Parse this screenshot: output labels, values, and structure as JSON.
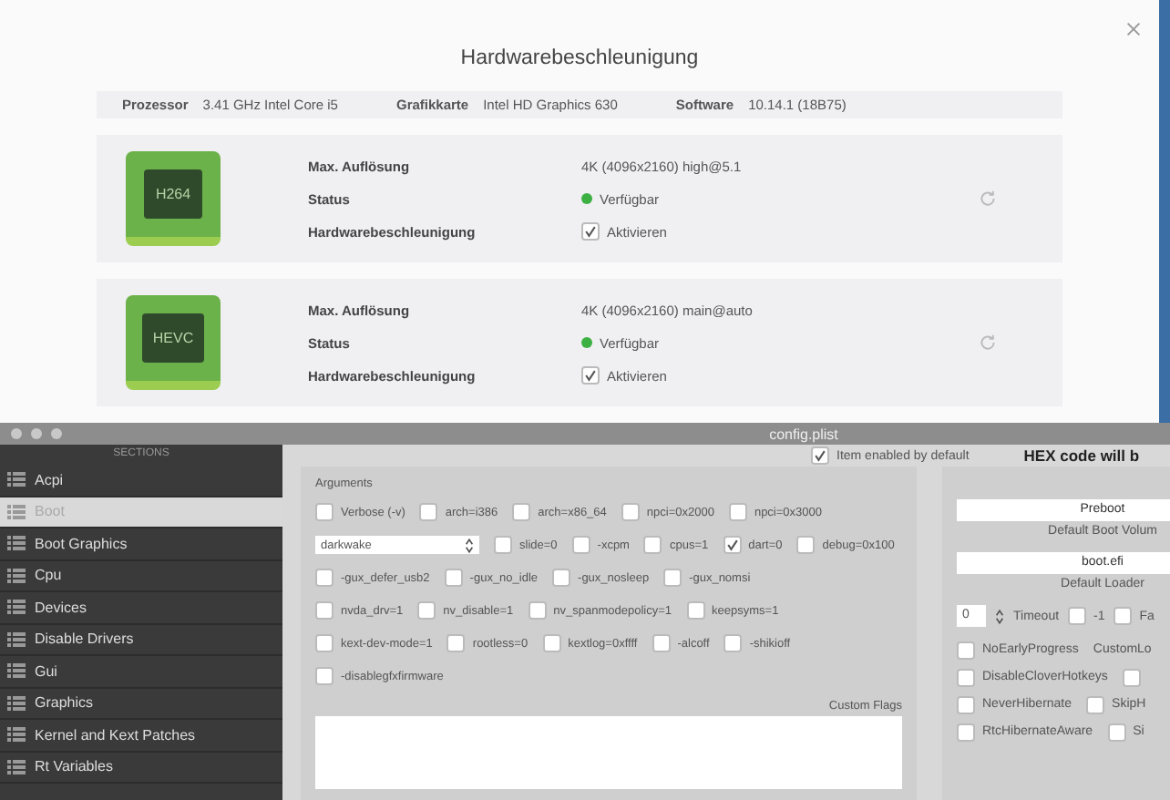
{
  "hardware_window": {
    "title": "Hardwarebeschleunigung",
    "info": [
      {
        "label": "Prozessor",
        "value": "3.41 GHz Intel Core i5"
      },
      {
        "label": "Grafikkarte",
        "value": "Intel HD Graphics 630"
      },
      {
        "label": "Software",
        "value": "10.14.1 (18B75)"
      }
    ],
    "codecs": [
      {
        "chip": "H264",
        "fields": [
          {
            "kind": "text",
            "label": "Max. Auflösung",
            "value": "4K (4096x2160) high@5.1"
          },
          {
            "kind": "status",
            "label": "Status",
            "value": "Verfügbar",
            "color": "#3cb043"
          },
          {
            "kind": "checkbox",
            "label": "Hardwarebeschleunigung",
            "value": "Aktivieren",
            "checked": true
          }
        ]
      },
      {
        "chip": "HEVC",
        "fields": [
          {
            "kind": "text",
            "label": "Max. Auflösung",
            "value": "4K (4096x2160) main@auto"
          },
          {
            "kind": "status",
            "label": "Status",
            "value": "Verfügbar",
            "color": "#3cb043"
          },
          {
            "kind": "checkbox",
            "label": "Hardwarebeschleunigung",
            "value": "Aktivieren",
            "checked": true
          }
        ]
      }
    ]
  },
  "config_window": {
    "title": "config.plist",
    "sidebar": {
      "header": "SECTIONS",
      "items": [
        {
          "label": "Acpi",
          "selected": false
        },
        {
          "label": "Boot",
          "selected": true
        },
        {
          "label": "Boot Graphics",
          "selected": false
        },
        {
          "label": "Cpu",
          "selected": false
        },
        {
          "label": "Devices",
          "selected": false
        },
        {
          "label": "Disable Drivers",
          "selected": false
        },
        {
          "label": "Gui",
          "selected": false
        },
        {
          "label": "Graphics",
          "selected": false
        },
        {
          "label": "Kernel and Kext Patches",
          "selected": false
        },
        {
          "label": "Rt Variables",
          "selected": false
        }
      ]
    },
    "item_enabled": {
      "label": "Item enabled by default",
      "checked": true
    },
    "hex_note": "HEX code will b",
    "arguments": {
      "label": "Arguments",
      "rows": [
        [
          {
            "kind": "checkbox",
            "label": "Verbose (-v)",
            "checked": false
          },
          {
            "kind": "checkbox",
            "label": "arch=i386",
            "checked": false
          },
          {
            "kind": "checkbox",
            "label": "arch=x86_64",
            "checked": false
          },
          {
            "kind": "checkbox",
            "label": "npci=0x2000",
            "checked": false
          },
          {
            "kind": "checkbox",
            "label": "npci=0x3000",
            "checked": false
          }
        ],
        [
          {
            "kind": "select",
            "label": "darkwake"
          },
          {
            "kind": "checkbox",
            "label": "slide=0",
            "checked": false
          },
          {
            "kind": "checkbox",
            "label": "-xcpm",
            "checked": false
          },
          {
            "kind": "checkbox",
            "label": "cpus=1",
            "checked": false
          },
          {
            "kind": "checkbox",
            "label": "dart=0",
            "checked": true
          },
          {
            "kind": "checkbox",
            "label": "debug=0x100",
            "checked": false
          }
        ],
        [
          {
            "kind": "checkbox",
            "label": "-gux_defer_usb2",
            "checked": false
          },
          {
            "kind": "checkbox",
            "label": "-gux_no_idle",
            "checked": false
          },
          {
            "kind": "checkbox",
            "label": "-gux_nosleep",
            "checked": false
          },
          {
            "kind": "checkbox",
            "label": "-gux_nomsi",
            "checked": false
          }
        ],
        [
          {
            "kind": "checkbox",
            "label": "nvda_drv=1",
            "checked": false
          },
          {
            "kind": "checkbox",
            "label": "nv_disable=1",
            "checked": false
          },
          {
            "kind": "checkbox",
            "label": "nv_spanmodepolicy=1",
            "checked": false
          },
          {
            "kind": "checkbox",
            "label": "keepsyms=1",
            "checked": false
          }
        ],
        [
          {
            "kind": "checkbox",
            "label": "kext-dev-mode=1",
            "checked": false
          },
          {
            "kind": "checkbox",
            "label": "rootless=0",
            "checked": false
          },
          {
            "kind": "checkbox",
            "label": "kextlog=0xffff",
            "checked": false
          },
          {
            "kind": "checkbox",
            "label": "-alcoff",
            "checked": false
          },
          {
            "kind": "checkbox",
            "label": "-shikioff",
            "checked": false
          }
        ],
        [
          {
            "kind": "checkbox",
            "label": "-disablegfxfirmware",
            "checked": false
          }
        ]
      ],
      "custom_flags_label": "Custom Flags"
    },
    "boot_volume": {
      "value": "Preboot",
      "label": "Default Boot Volum"
    },
    "loader": {
      "value": "boot.efi",
      "label": "Default Loader"
    },
    "timeout": {
      "value": "0",
      "label": "Timeout",
      "options": [
        {
          "label": "-1",
          "checked": false
        },
        {
          "label": "Fa",
          "checked": false
        }
      ]
    },
    "flags": [
      [
        {
          "kind": "checkbox",
          "label": "NoEarlyProgress",
          "checked": false
        },
        {
          "kind": "text",
          "label": "CustomLo"
        }
      ],
      [
        {
          "kind": "checkbox",
          "label": "DisableCloverHotkeys",
          "checked": false
        },
        {
          "kind": "checkbox",
          "checked": false
        }
      ],
      [
        {
          "kind": "checkbox",
          "label": "NeverHibernate",
          "checked": false
        },
        {
          "kind": "checkbox",
          "label": "SkipH",
          "checked": false
        }
      ],
      [
        {
          "kind": "checkbox",
          "label": "RtcHibernateAware",
          "checked": false
        },
        {
          "kind": "checkbox",
          "label": "Si",
          "checked": false
        }
      ]
    ]
  }
}
